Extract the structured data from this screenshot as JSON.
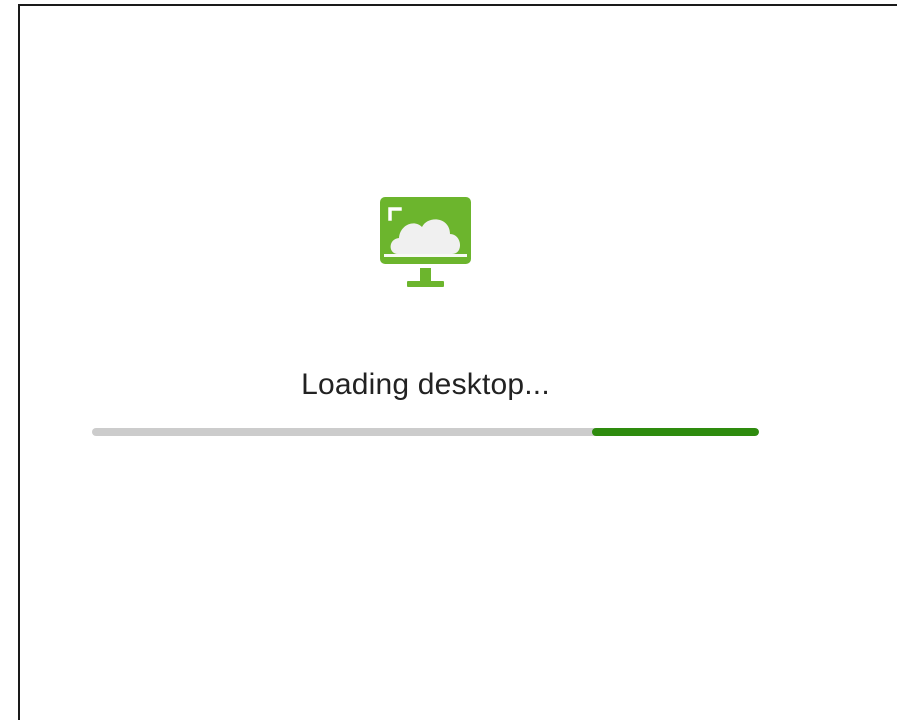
{
  "loader": {
    "icon": "cloud-desktop-icon",
    "status_text": "Loading desktop...",
    "progress": {
      "indicator_start_fraction": 0.75,
      "indicator_end_fraction": 1.0
    }
  },
  "colors": {
    "icon_green": "#6cb52d",
    "icon_cloud": "#f0f0f0",
    "progress_fill": "#2e8b0e",
    "progress_track": "#cccccc",
    "text": "#222222",
    "border": "#1a1a1a"
  }
}
